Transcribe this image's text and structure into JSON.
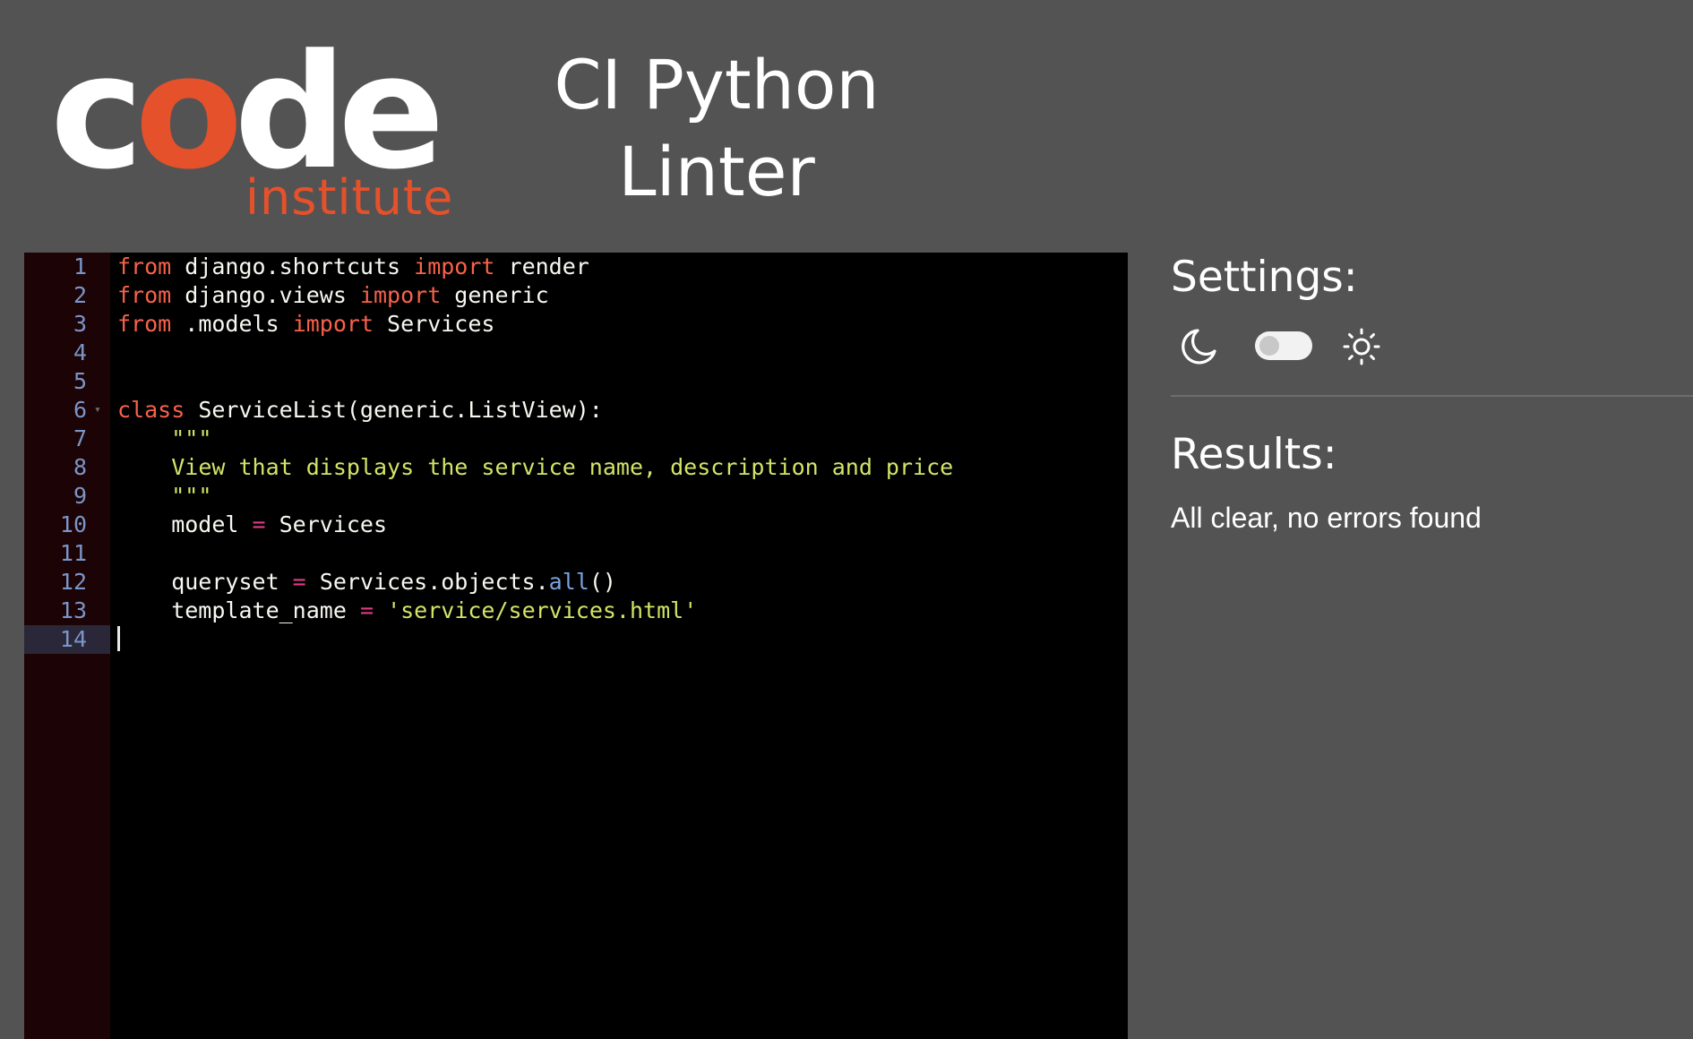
{
  "header": {
    "logo": {
      "word_pre": "c",
      "word_o": "o",
      "word_post": "de",
      "sub": "institute",
      "colors": {
        "primary": "#ffffff",
        "accent": "#e5512b"
      }
    },
    "title_line1": "CI Python",
    "title_line2": "Linter"
  },
  "editor": {
    "active_line": 14,
    "lines": [
      {
        "n": "1",
        "tokens": [
          {
            "t": "kw",
            "v": "from"
          },
          {
            "t": "plain",
            "v": " django.shortcuts "
          },
          {
            "t": "kw",
            "v": "import"
          },
          {
            "t": "plain",
            "v": " render"
          }
        ]
      },
      {
        "n": "2",
        "tokens": [
          {
            "t": "kw",
            "v": "from"
          },
          {
            "t": "plain",
            "v": " django.views "
          },
          {
            "t": "kw",
            "v": "import"
          },
          {
            "t": "plain",
            "v": " generic"
          }
        ]
      },
      {
        "n": "3",
        "tokens": [
          {
            "t": "kw",
            "v": "from"
          },
          {
            "t": "plain",
            "v": " .models "
          },
          {
            "t": "kw",
            "v": "import"
          },
          {
            "t": "plain",
            "v": " Services"
          }
        ]
      },
      {
        "n": "4",
        "tokens": []
      },
      {
        "n": "5",
        "tokens": []
      },
      {
        "n": "6",
        "fold": true,
        "tokens": [
          {
            "t": "kw",
            "v": "class"
          },
          {
            "t": "plain",
            "v": " ServiceList(generic.ListView):"
          }
        ]
      },
      {
        "n": "7",
        "tokens": [
          {
            "t": "plain",
            "v": "    "
          },
          {
            "t": "str",
            "v": "\"\"\""
          }
        ]
      },
      {
        "n": "8",
        "tokens": [
          {
            "t": "plain",
            "v": "    "
          },
          {
            "t": "str",
            "v": "View that displays the service name, description and price"
          }
        ]
      },
      {
        "n": "9",
        "tokens": [
          {
            "t": "plain",
            "v": "    "
          },
          {
            "t": "str",
            "v": "\"\"\""
          }
        ]
      },
      {
        "n": "10",
        "tokens": [
          {
            "t": "plain",
            "v": "    model "
          },
          {
            "t": "op",
            "v": "="
          },
          {
            "t": "plain",
            "v": " Services"
          }
        ]
      },
      {
        "n": "11",
        "tokens": []
      },
      {
        "n": "12",
        "tokens": [
          {
            "t": "plain",
            "v": "    queryset "
          },
          {
            "t": "op",
            "v": "="
          },
          {
            "t": "plain",
            "v": " Services.objects."
          },
          {
            "t": "fn",
            "v": "all"
          },
          {
            "t": "plain",
            "v": "()"
          }
        ]
      },
      {
        "n": "13",
        "tokens": [
          {
            "t": "plain",
            "v": "    template_name "
          },
          {
            "t": "op",
            "v": "="
          },
          {
            "t": "plain",
            "v": " "
          },
          {
            "t": "str",
            "v": "'service/services.html'"
          }
        ]
      },
      {
        "n": "14",
        "cursor": true,
        "tokens": []
      }
    ],
    "colors": {
      "background": "#000000",
      "gutter": "#1c0306",
      "line_number": "#7a95c8",
      "keyword": "#f8624a",
      "string": "#d3e467",
      "operator": "#e03b86",
      "function": "#79a3e0",
      "text": "#f8f8f2"
    }
  },
  "settings": {
    "heading": "Settings:",
    "theme_toggle": {
      "left_icon": "moon-icon",
      "right_icon": "sun-icon",
      "state": "dark"
    }
  },
  "results": {
    "heading": "Results:",
    "message": "All clear, no errors found"
  },
  "colors": {
    "page_background": "#535353",
    "divider": "#6d6d6d"
  }
}
